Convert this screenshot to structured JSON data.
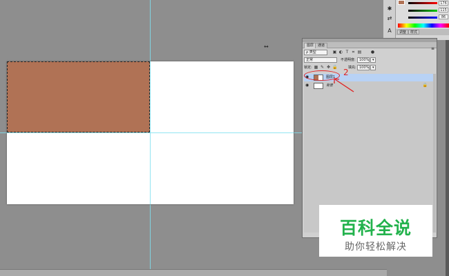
{
  "canvas": {
    "fill_color": "#b07255",
    "guide_color": "#7fe0f0",
    "cursor_glyph": "↔"
  },
  "color_panel": {
    "values": [
      "176",
      "115",
      "86"
    ],
    "tabs": [
      "调整",
      "样式"
    ]
  },
  "layers_panel": {
    "tabs": [
      "图层",
      "通道"
    ],
    "menu_glyph": "≡",
    "filter_kind": "ρ 类型",
    "blend_mode": "正常",
    "opacity_label": "不透明度:",
    "opacity_value": "100%",
    "lock_label": "锁定:",
    "fill_label": "填充:",
    "fill_value": "100%",
    "layers": [
      {
        "name": "图层1",
        "selected": true
      },
      {
        "name": "背景",
        "selected": false
      }
    ]
  },
  "annotation": {
    "number": "2",
    "color": "#e02020"
  },
  "watermark": {
    "title": "百科全说",
    "subtitle": "助你轻松解决",
    "title_color": "#22b24c"
  }
}
